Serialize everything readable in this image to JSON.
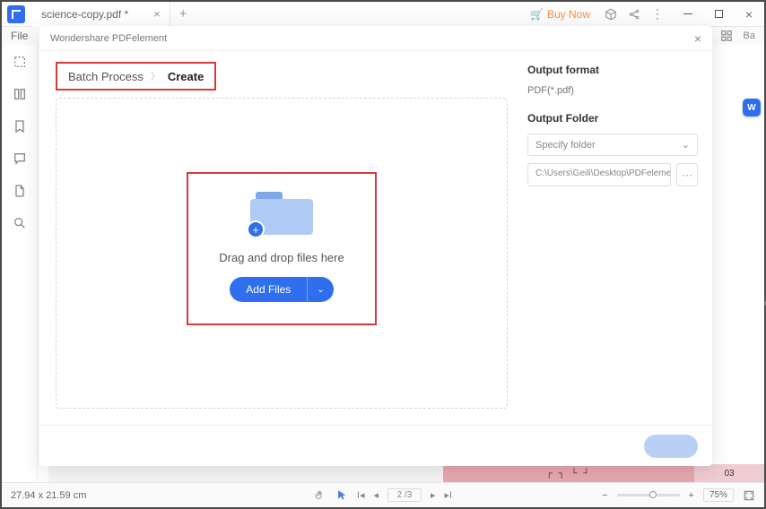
{
  "titlebar": {
    "tabTitle": "science-copy.pdf *",
    "buyNow": "Buy Now"
  },
  "filebar": {
    "file": "File",
    "ba": "Ba"
  },
  "modal": {
    "title": "Wondershare PDFelement",
    "breadcrumb": {
      "root": "Batch Process",
      "current": "Create"
    },
    "dropText": "Drag and drop files here",
    "addFiles": "Add Files",
    "right": {
      "outputFormatLabel": "Output format",
      "outputFormatValue": "PDF(*.pdf)",
      "outputFolderLabel": "Output Folder",
      "specifyFolder": "Specify folder",
      "folderPath": "C:\\Users\\Geili\\Desktop\\PDFelement\\Cr"
    }
  },
  "docstrip": {
    "mid": "┌ ┐ └ ┘",
    "right": "03"
  },
  "statusbar": {
    "dims": "27.94 x 21.59 cm",
    "page": "2 /3",
    "zoom": "75%"
  },
  "badgeW": "W"
}
